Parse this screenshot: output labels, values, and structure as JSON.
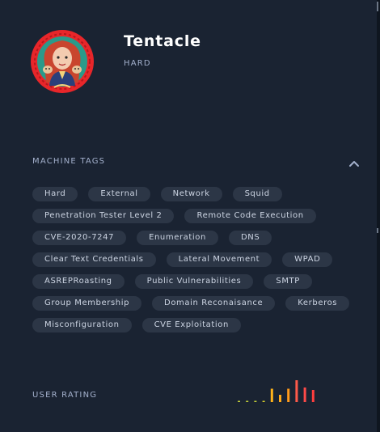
{
  "machine": {
    "name": "Tentacle",
    "difficulty": "HARD",
    "avatar_icon": "red-haired-pirate-avatar-icon"
  },
  "sections": {
    "tags_title": "MACHINE TAGS",
    "rating_title": "USER RATING"
  },
  "tags": [
    [
      "Hard",
      "External",
      "Network",
      "Squid"
    ],
    [
      "Penetration Tester Level 2",
      "Remote Code Execution"
    ],
    [
      "CVE-2020-7247",
      "Enumeration",
      "DNS"
    ],
    [
      "Clear Text Credentials",
      "Lateral Movement",
      "WPAD"
    ],
    [
      "ASREPRoasting",
      "Public Vulnerabilities",
      "SMTP"
    ],
    [
      "Group Membership",
      "Domain Reconaisance",
      "Kerberos"
    ],
    [
      "Misconfiguration",
      "CVE Exploitation"
    ]
  ],
  "user_rating": {
    "levels": [
      0.05,
      0.05,
      0.05,
      0.05,
      0.55,
      0.3,
      0.55,
      0.9,
      0.6,
      0.5
    ],
    "colors": [
      "#c6d23a",
      "#c6d23a",
      "#c6d23a",
      "#d8cf2a",
      "#ffb31a",
      "#ffaa1a",
      "#ff9a1a",
      "#ff5a4a",
      "#ff4a48",
      "#ff3e3e"
    ]
  },
  "colors": {
    "background": "#1a2332",
    "tag_background": "#2c3646",
    "accent_red": "#e8262a"
  }
}
